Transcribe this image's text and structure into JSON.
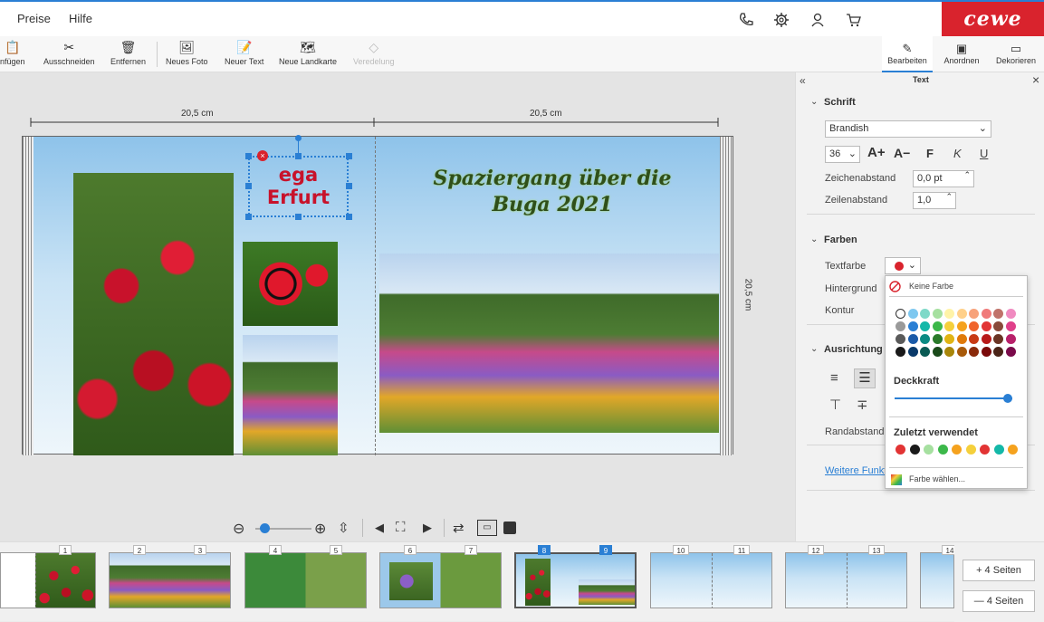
{
  "topbar": {
    "menu": [
      "Preise",
      "Hilfe"
    ],
    "logo": "cewe",
    "icons": [
      "phone-icon",
      "gear-icon",
      "user-icon",
      "cart-icon"
    ]
  },
  "toolbar": {
    "items": [
      {
        "label": "nfügen",
        "icon": "paste-icon"
      },
      {
        "label": "Ausschneiden",
        "icon": "scissors-icon"
      },
      {
        "label": "Entfernen",
        "icon": "trash-icon"
      },
      {
        "label": "Neues Foto",
        "icon": "photo-icon"
      },
      {
        "label": "Neuer Text",
        "icon": "text-icon"
      },
      {
        "label": "Neue Landkarte",
        "icon": "map-icon"
      },
      {
        "label": "Veredelung",
        "icon": "diamond-icon"
      }
    ],
    "right_tabs": [
      "Bearbeiten",
      "Anordnen",
      "Dekorieren"
    ]
  },
  "canvas": {
    "dim_left": "20,5 cm",
    "dim_right": "20,5 cm",
    "dim_side": "20,5 cm",
    "textbox": {
      "line1": "ega",
      "line2": "Erfurt"
    },
    "title": {
      "line1": "Spaziergang über die",
      "line2": "Buga 2021"
    }
  },
  "zoom": {
    "value": 0.08
  },
  "panel": {
    "title": "Text",
    "collapse": "«",
    "close": "×",
    "schrift": {
      "heading": "Schrift",
      "font": "Brandish",
      "size": "36",
      "grow": "A+",
      "shrink": "A−",
      "bold": "F",
      "italic": "K",
      "underline": "U",
      "spacing_label": "Zeichenabstand",
      "spacing_value": "0,0 pt",
      "line_label": "Zeilenabstand",
      "line_value": "1,0"
    },
    "farben": {
      "heading": "Farben",
      "text_label": "Textfarbe",
      "text_color": "#d9232d",
      "bg_label": "Hintergrund",
      "contour_label": "Kontur"
    },
    "ausrichtung": {
      "heading": "Ausrichtung",
      "margin_label": "Randabstand"
    },
    "link": "Weitere Funkt"
  },
  "color_popup": {
    "none": "Keine Farbe",
    "grid": [
      [
        "#ffffff",
        "#7ec8f0",
        "#7ed9c8",
        "#a6e0a0",
        "#fff3a8",
        "#ffd08a",
        "#f7a27a",
        "#f07a7a",
        "#c0726a",
        "#f08ac0"
      ],
      [
        "#9a9a9a",
        "#2a7fd4",
        "#14b8a8",
        "#3cb84a",
        "#f5d03c",
        "#f5a21e",
        "#f0642c",
        "#e23434",
        "#8a4a3a",
        "#e0408a"
      ],
      [
        "#5a5a5a",
        "#1a5aa8",
        "#0a8a82",
        "#2a7a2a",
        "#e0b414",
        "#e07a0a",
        "#c83a14",
        "#b81a1a",
        "#6a3424",
        "#b8206a"
      ],
      [
        "#1a1a1a",
        "#0a3a6a",
        "#0a5a54",
        "#1a4a1a",
        "#a8860a",
        "#a85a0a",
        "#8a2a0a",
        "#7a0a0a",
        "#4a2418",
        "#7a0a4a"
      ]
    ],
    "opacity_label": "Deckkraft",
    "opacity_value": 0.96,
    "recent_label": "Zuletzt verwendet",
    "recent": [
      "#e23434",
      "#1a1a1a",
      "#a6e0a0",
      "#3cb84a",
      "#f5a21e",
      "#f5d03c",
      "#e23434",
      "#14b8a8",
      "#f5a21e"
    ],
    "choose": "Farbe wählen..."
  },
  "pages": {
    "numbers": [
      "1",
      "2",
      "3",
      "4",
      "5",
      "6",
      "7",
      "8",
      "9",
      "10",
      "11",
      "12",
      "13",
      "14"
    ],
    "selected": [
      "8",
      "9"
    ],
    "add": "+ 4 Seiten",
    "remove": "— 4 Seiten"
  }
}
